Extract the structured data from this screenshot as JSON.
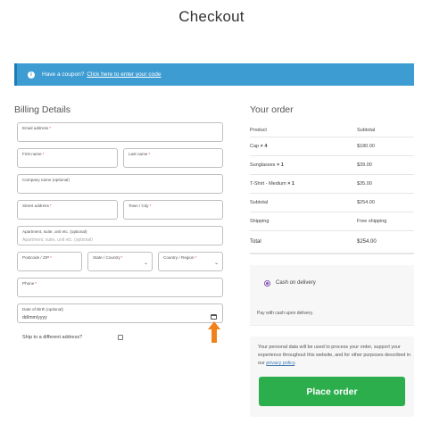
{
  "page": {
    "title": "Checkout"
  },
  "coupon": {
    "text": "Have a coupon?",
    "link": "Click here to enter your code"
  },
  "billing": {
    "title": "Billing Details",
    "fields": {
      "email": {
        "label": "Email address",
        "required": "*"
      },
      "first_name": {
        "label": "First name",
        "required": "*"
      },
      "last_name": {
        "label": "Last name",
        "required": "*"
      },
      "company": {
        "label": "Company name (optional)"
      },
      "street": {
        "label": "Street address",
        "required": "*"
      },
      "town": {
        "label": "Town / City",
        "required": "*"
      },
      "apartment": {
        "label": "Apartment, suite, unit etc. (optional)",
        "placeholder": "Apartment, suite, unit etc. (optional)"
      },
      "postcode": {
        "label": "Postcode / ZIP",
        "required": "*"
      },
      "state": {
        "label": "State / Country",
        "required": "*"
      },
      "country": {
        "label": "Country / Region",
        "required": "*"
      },
      "phone": {
        "label": "Phone",
        "required": "*"
      },
      "dob": {
        "label": "Date of Birth (optional)",
        "value": "dd/mm/yyyy"
      }
    },
    "ship_different": "Ship to a different address?"
  },
  "order": {
    "title": "Your order",
    "headers": {
      "product": "Product",
      "subtotal": "Subtotal"
    },
    "items": [
      {
        "name": "Cap",
        "qty": "× 4",
        "subtotal": "$180.00"
      },
      {
        "name": "Sunglasses",
        "qty": "× 1",
        "subtotal": "$39.00"
      },
      {
        "name": "T-Shirt - Medium",
        "qty": "× 1",
        "subtotal": "$35.00"
      }
    ],
    "subtotal": {
      "label": "Subtotal",
      "value": "$254.00"
    },
    "shipping": {
      "label": "Shipping",
      "value": "Free shipping"
    },
    "total": {
      "label": "Total",
      "value": "$254.00"
    }
  },
  "payment": {
    "method": "Cash on delivery",
    "description": "Pay with cash upon delivery."
  },
  "privacy": {
    "text": "Your personal data will be used to process your order, support your experience throughout this website, and for other purposes described in our",
    "link": "privacy policy",
    "end": "."
  },
  "place_order": {
    "label": "Place order"
  },
  "colors": {
    "coupon_bg": "#3d9cd2",
    "place_order_bg": "#2dae4d",
    "arrow": "#f0821e",
    "radio": "#7f54b3",
    "required": "#e2401c"
  }
}
